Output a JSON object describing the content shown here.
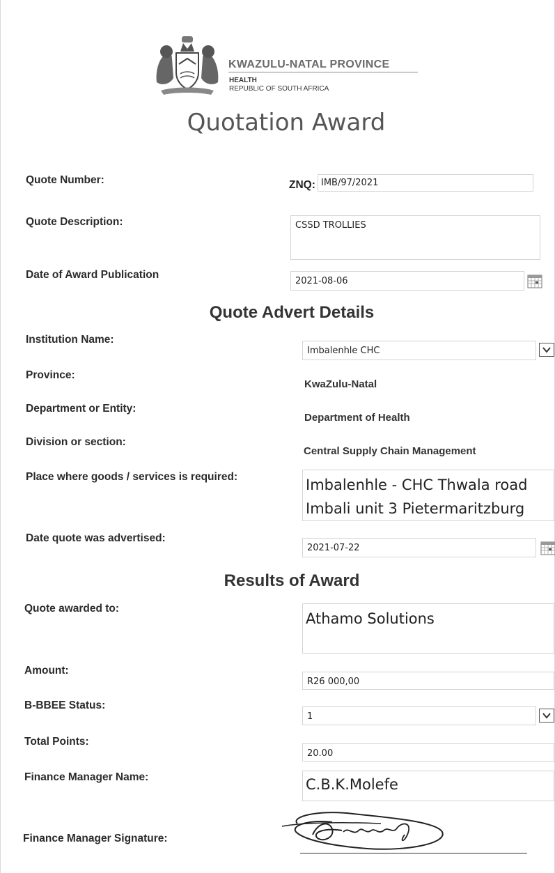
{
  "header": {
    "org_name": "KWAZULU-NATAL PROVINCE",
    "department": "HEALTH",
    "country": "REPUBLIC OF SOUTH AFRICA"
  },
  "title": "Quotation Award",
  "quote": {
    "number_label": "Quote Number:",
    "number_prefix": "ZNQ:",
    "number_value": "IMB/97/2021",
    "description_label": "Quote Description:",
    "description_value": "CSSD TROLLIES",
    "award_date_label": "Date of Award Publication",
    "award_date_value": "2021-08-06"
  },
  "advert": {
    "heading": "Quote Advert Details",
    "institution_label": "Institution Name:",
    "institution_value": "Imbalenhle CHC",
    "province_label": "Province:",
    "province_value": "KwaZulu-Natal",
    "department_label": "Department or Entity:",
    "department_value": "Department of Health",
    "division_label": "Division or section:",
    "division_value": "Central Supply Chain Management",
    "place_label": "Place where goods /  services is required:",
    "place_value": "Imbalenhle - CHC Thwala road Imbali unit 3 Pietermaritzburg",
    "advert_date_label": "Date quote was advertised:",
    "advert_date_value": "2021-07-22"
  },
  "results": {
    "heading": "Results of Award",
    "awarded_to_label": "Quote awarded to:",
    "awarded_to_value": "Athamo Solutions",
    "amount_label": "Amount:",
    "amount_value": "R26 000,00",
    "bbbee_label": "B-BBEE Status:",
    "bbbee_value": "1",
    "points_label": "Total Points:",
    "points_value": "20.00",
    "manager_label": "Finance Manager Name:",
    "manager_value": "C.B.K.Molefe",
    "signature_label": "Finance Manager Signature:"
  },
  "icons": {
    "calendar": "calendar-icon",
    "dropdown": "chevron-down-icon",
    "crest": "coat-of-arms"
  }
}
